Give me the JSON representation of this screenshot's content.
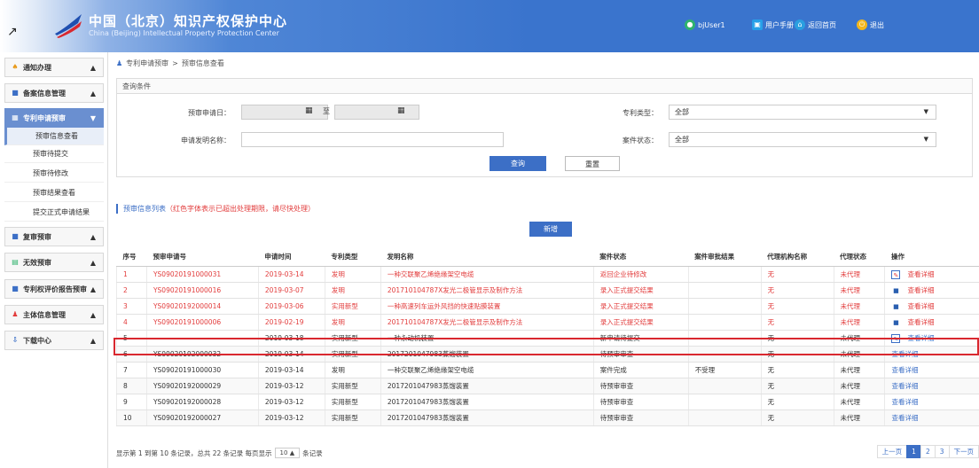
{
  "header": {
    "title_cn": "中国（北京）知识产权保护中心",
    "title_en": "China (Beijing) Intellectual Property Protection Center",
    "user": "bjUser1",
    "manual": "用户手册",
    "home": "返回首页",
    "logout": "退出"
  },
  "sidebar": {
    "items": [
      {
        "label": "通知办理"
      },
      {
        "label": "备案信息管理"
      },
      {
        "label": "专利申请预审"
      },
      {
        "label": "复审预审"
      },
      {
        "label": "无效预审"
      },
      {
        "label": "专利权评价报告预审"
      },
      {
        "label": "主体信息管理"
      },
      {
        "label": "下载中心"
      }
    ],
    "subitems": [
      {
        "label": "预审信息查看"
      },
      {
        "label": "预审待提交"
      },
      {
        "label": "预审待修改"
      },
      {
        "label": "预审结果查看"
      },
      {
        "label": "提交正式申请结果"
      }
    ]
  },
  "breadcrumb": {
    "parent": "专利申请预审",
    "sep": ">",
    "current": "预审信息查看"
  },
  "query": {
    "title": "查询条件",
    "date_label": "预审申请日：",
    "to": "至",
    "name_label": "申请发明名称：",
    "type_label": "专利类型：",
    "type_value": "全部",
    "status_label": "案件状态：",
    "status_value": "全部",
    "search": "查询",
    "reset": "重置"
  },
  "list": {
    "title": "预审信息列表",
    "note": "（红色字体表示已超出处理期限，请尽快处理）",
    "new": "新增"
  },
  "table": {
    "headers": [
      "序号",
      "预审申请号",
      "申请时间",
      "专利类型",
      "发明名称",
      "案件状态",
      "案件审批结果",
      "代理机构名称",
      "代理状态",
      "操作"
    ],
    "rows": [
      {
        "no": "1",
        "app": "YS09020191000031",
        "time": "2019-03-14",
        "type": "发明",
        "name": "一种交联聚乙烯绝缘架空电缆",
        "status": "返回企业待修改",
        "result": "",
        "agency": "无",
        "astatus": "未代理",
        "op": "查看详细"
      },
      {
        "no": "2",
        "app": "YS09020191000016",
        "time": "2019-03-07",
        "type": "发明",
        "name": "201710104787X发光二极管显示及制作方法",
        "status": "录入正式提交结果",
        "result": "",
        "agency": "无",
        "astatus": "未代理",
        "op": "查看详细"
      },
      {
        "no": "3",
        "app": "YS09020192000014",
        "time": "2019-03-06",
        "type": "实用新型",
        "name": "一种高速列车运外风挡的快速贴膜装置",
        "status": "录入正式提交结果",
        "result": "",
        "agency": "无",
        "astatus": "未代理",
        "op": "查看详细"
      },
      {
        "no": "4",
        "app": "YS09020191000006",
        "time": "2019-02-19",
        "type": "发明",
        "name": "201710104787X发光二极管显示及制作方法",
        "status": "录入正式提交结果",
        "result": "",
        "agency": "无",
        "astatus": "未代理",
        "op": "查看详细"
      },
      {
        "no": "5",
        "app": "-",
        "time": "2019-03-18",
        "type": "实用新型",
        "name": "一种永动机装置",
        "status": "新申请待提交",
        "result": "",
        "agency": "无",
        "astatus": "未代理",
        "op": "查看详细"
      },
      {
        "no": "6",
        "app": "YS09020192000032",
        "time": "2019-03-14",
        "type": "实用新型",
        "name": "2017201047983蒸馏装置",
        "status": "待预审审查",
        "result": "",
        "agency": "无",
        "astatus": "未代理",
        "op": "查看详细"
      },
      {
        "no": "7",
        "app": "YS09020191000030",
        "time": "2019-03-14",
        "type": "发明",
        "name": "一种交联聚乙烯绝缘架空电缆",
        "status": "案件完成",
        "result": "不受理",
        "agency": "无",
        "astatus": "未代理",
        "op": "查看详细"
      },
      {
        "no": "8",
        "app": "YS09020192000029",
        "time": "2019-03-12",
        "type": "实用新型",
        "name": "2017201047983蒸馏装置",
        "status": "待预审审查",
        "result": "",
        "agency": "无",
        "astatus": "未代理",
        "op": "查看详细"
      },
      {
        "no": "9",
        "app": "YS09020192000028",
        "time": "2019-03-12",
        "type": "实用新型",
        "name": "2017201047983蒸馏装置",
        "status": "待预审审查",
        "result": "",
        "agency": "无",
        "astatus": "未代理",
        "op": "查看详细"
      },
      {
        "no": "10",
        "app": "YS09020192000027",
        "time": "2019-03-12",
        "type": "实用新型",
        "name": "2017201047983蒸馏装置",
        "status": "待预审审查",
        "result": "",
        "agency": "无",
        "astatus": "未代理",
        "op": "查看详细"
      }
    ]
  },
  "footer": {
    "info": "显示第 1 到第 10 条记录，总共 22 条记录 每页显示",
    "per_page": "10",
    "suffix": "条记录",
    "prev": "上一页",
    "pages": [
      "1",
      "2",
      "3"
    ],
    "next": "下一页"
  },
  "colors": {
    "accent": "#3c6fc6",
    "overdue": "#e23c3c",
    "highlight": "#d9282f"
  }
}
